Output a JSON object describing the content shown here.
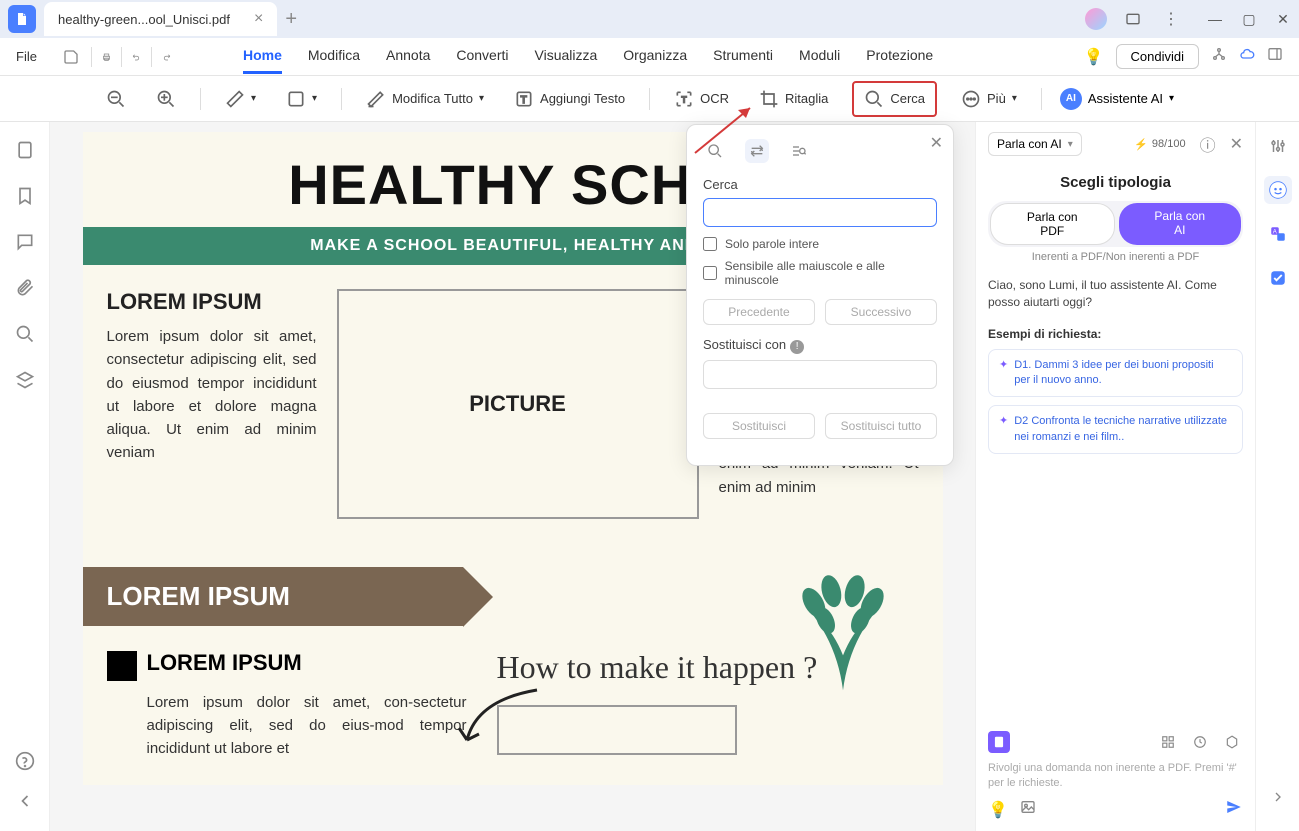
{
  "titlebar": {
    "tab_title": "healthy-green...ool_Unisci.pdf"
  },
  "menubar": {
    "file": "File",
    "tabs": {
      "home": "Home",
      "modifica": "Modifica",
      "annota": "Annota",
      "converti": "Converti",
      "visualizza": "Visualizza",
      "organizza": "Organizza",
      "strumenti": "Strumenti",
      "moduli": "Moduli",
      "protezione": "Protezione"
    },
    "share": "Condividi"
  },
  "toolbar": {
    "modifica_tutto": "Modifica Tutto",
    "aggiungi_testo": "Aggiungi Testo",
    "ocr": "OCR",
    "ritaglia": "Ritaglia",
    "cerca": "Cerca",
    "piu": "Più",
    "assistente_ai": "Assistente AI"
  },
  "document": {
    "title": "HEALTHY SCHO",
    "subtitle": "MAKE A SCHOOL BEAUTIFUL, HEALTHY AND A",
    "lorem_heading": "LOREM IPSUM",
    "lorem_text": "Lorem ipsum dolor sit amet, consectetur adipiscing elit, sed do eiusmod tempor incididunt ut labore et dolore magna aliqua. Ut enim ad minim veniam",
    "picture_label": "PICTURE",
    "col3_text_fragment": "et dolore magna aliqua. Ut enim ad minim veniam. Ut enim ad minim",
    "banner_text": "LOREM IPSUM",
    "lower_heading": "LOREM IPSUM",
    "lower_text": "Lorem ipsum dolor sit amet, con-sectetur adipiscing elit, sed do eius-mod tempor incididunt ut labore et",
    "script_text": "How to make it happen ?"
  },
  "search_panel": {
    "cerca_label": "Cerca",
    "whole_words": "Solo parole intere",
    "case_sensitive": "Sensibile alle maiuscole e alle minuscole",
    "prev": "Precedente",
    "next": "Successivo",
    "replace_label": "Sostituisci con",
    "replace_btn": "Sostituisci",
    "replace_all_btn": "Sostituisci tutto"
  },
  "ai_panel": {
    "mode_select": "Parla con AI",
    "credits": "98/100",
    "title": "Scegli tipologia",
    "toggle_left_line1": "Parla con",
    "toggle_left_line2": "PDF",
    "toggle_right_line1": "Parla con",
    "toggle_right_line2": "AI",
    "subtitle": "Inerenti a PDF/Non inerenti a PDF",
    "greeting": "Ciao, sono Lumi, il tuo assistente AI. Come posso aiutarti oggi?",
    "examples_label": "Esempi di richiesta:",
    "example1": "D1. Dammi 3 idee per dei buoni propositi per il nuovo anno.",
    "example2": "D2 Confronta le tecniche narrative utilizzate nei romanzi e nei film..",
    "input_hint": "Rivolgi una domanda non inerente a PDF. Premi '#' per le richieste."
  }
}
